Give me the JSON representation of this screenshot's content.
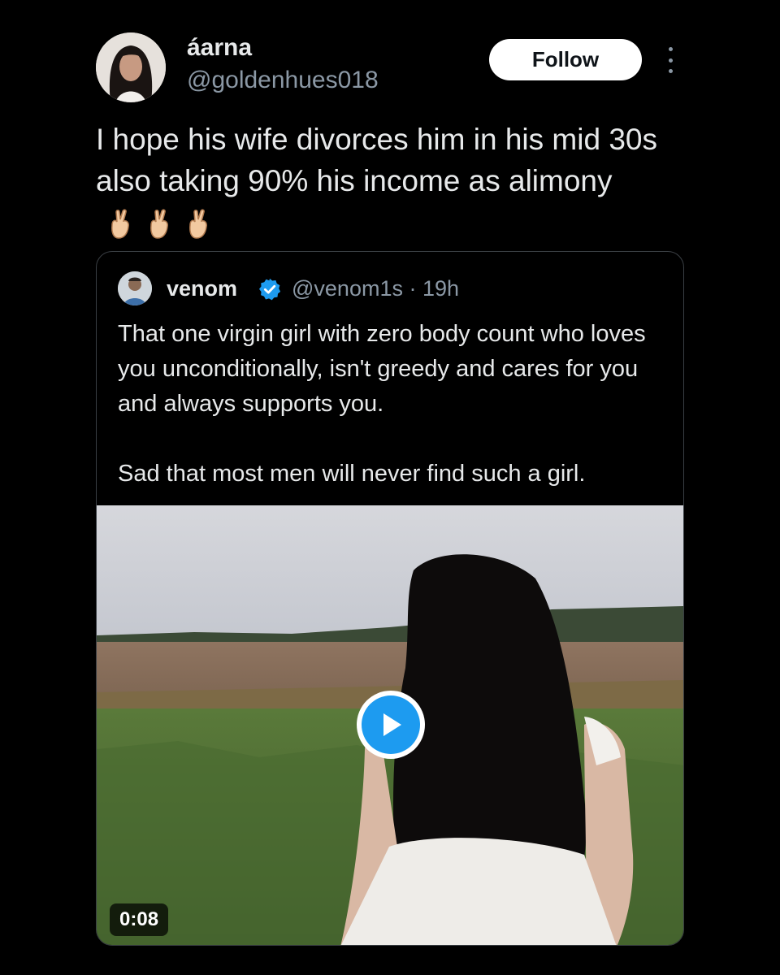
{
  "author": {
    "display_name": "áarna",
    "handle": "@goldenhues018",
    "avatar_icon": "profile-photo-woman"
  },
  "follow_label": "Follow",
  "more_icon": "more-vertical-icon",
  "tweet": {
    "text": "I hope his wife divorces him in his mid 30s also taking 90% his income as alimony",
    "emojis": [
      "crossed-fingers",
      "crossed-fingers",
      "crossed-fingers"
    ]
  },
  "quoted": {
    "display_name": "venom",
    "verified": true,
    "meta": "@venom1s · 19h",
    "paragraphs": [
      "That one virgin girl with zero body count who loves you unconditionally, isn't greedy and cares for you and always supports you.",
      "Sad that most men will never find such a girl."
    ],
    "media": {
      "type": "video",
      "duration": "0:08",
      "description_icon": "video-thumbnail-field-girl"
    }
  },
  "colors": {
    "background": "#000000",
    "text": "#e7e9ea",
    "secondary": "#8b98a5",
    "accent": "#1d9bf0",
    "border": "#3a3f44"
  }
}
